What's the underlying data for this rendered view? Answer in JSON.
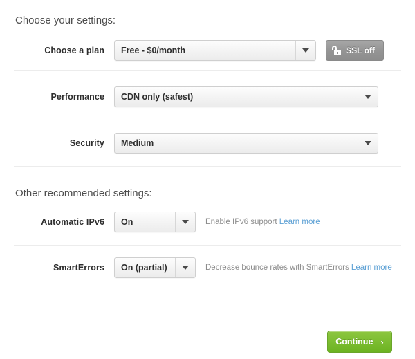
{
  "sections": {
    "primary_heading": "Choose your settings:",
    "secondary_heading": "Other recommended settings:"
  },
  "rows": {
    "plan": {
      "label": "Choose a plan",
      "value": "Free - $0/month"
    },
    "performance": {
      "label": "Performance",
      "value": "CDN only (safest)"
    },
    "security": {
      "label": "Security",
      "value": "Medium"
    },
    "ipv6": {
      "label": "Automatic IPv6",
      "value": "On",
      "hint_text": "Enable IPv6 support",
      "hint_link": "Learn more"
    },
    "smarterrors": {
      "label": "SmartErrors",
      "value": "On (partial)",
      "hint_text": "Decrease bounce rates with SmartErrors",
      "hint_link": "Learn more"
    }
  },
  "ssl_button": {
    "label": "SSL off",
    "icon": "open-padlock-icon"
  },
  "continue_button": {
    "label": "Continue",
    "icon": "chevron-right-icon",
    "glyph": "›"
  },
  "colors": {
    "accent_green": "#7cbd31",
    "link_blue": "#5a9fd4",
    "ssl_gray": "#949494",
    "divider": "#ececec",
    "hint_text": "#8c8c8c"
  }
}
